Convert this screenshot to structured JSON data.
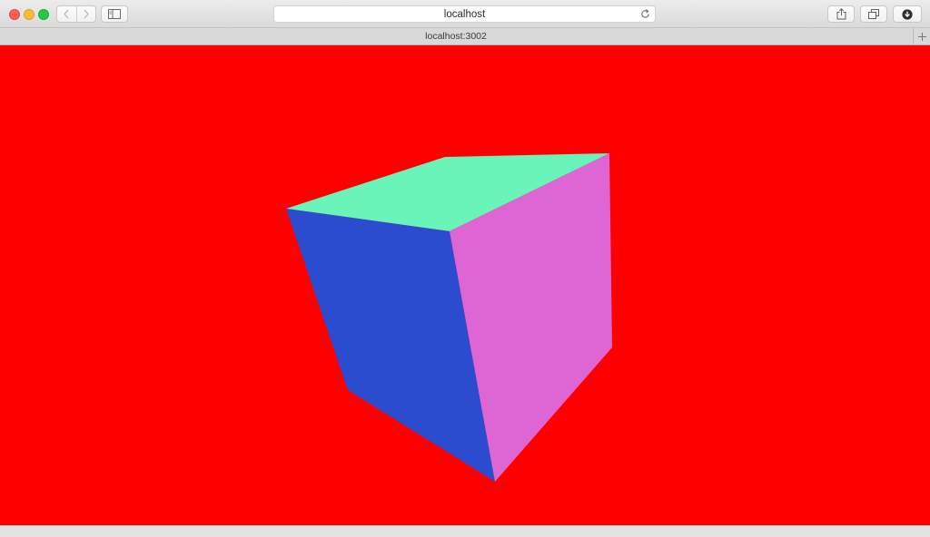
{
  "browser": {
    "address_bar": {
      "value": "localhost"
    },
    "tab": {
      "title": "localhost:3002"
    }
  },
  "icons": {
    "back": "chevron-left-icon",
    "forward": "chevron-right-icon",
    "sidebar": "sidebar-icon",
    "reload": "reload-icon",
    "share": "share-icon",
    "tabs": "tabs-overview-icon",
    "downloads": "download-icon",
    "new_tab": "plus-icon"
  },
  "colors": {
    "page_background": "#ff0000",
    "cube_top": "#69f4b9",
    "cube_left": "#2c4ccf",
    "cube_right": "#dd66d4",
    "traffic_close": "#fc5f57",
    "traffic_minimize": "#fdbc2e",
    "traffic_maximize": "#28c840"
  }
}
